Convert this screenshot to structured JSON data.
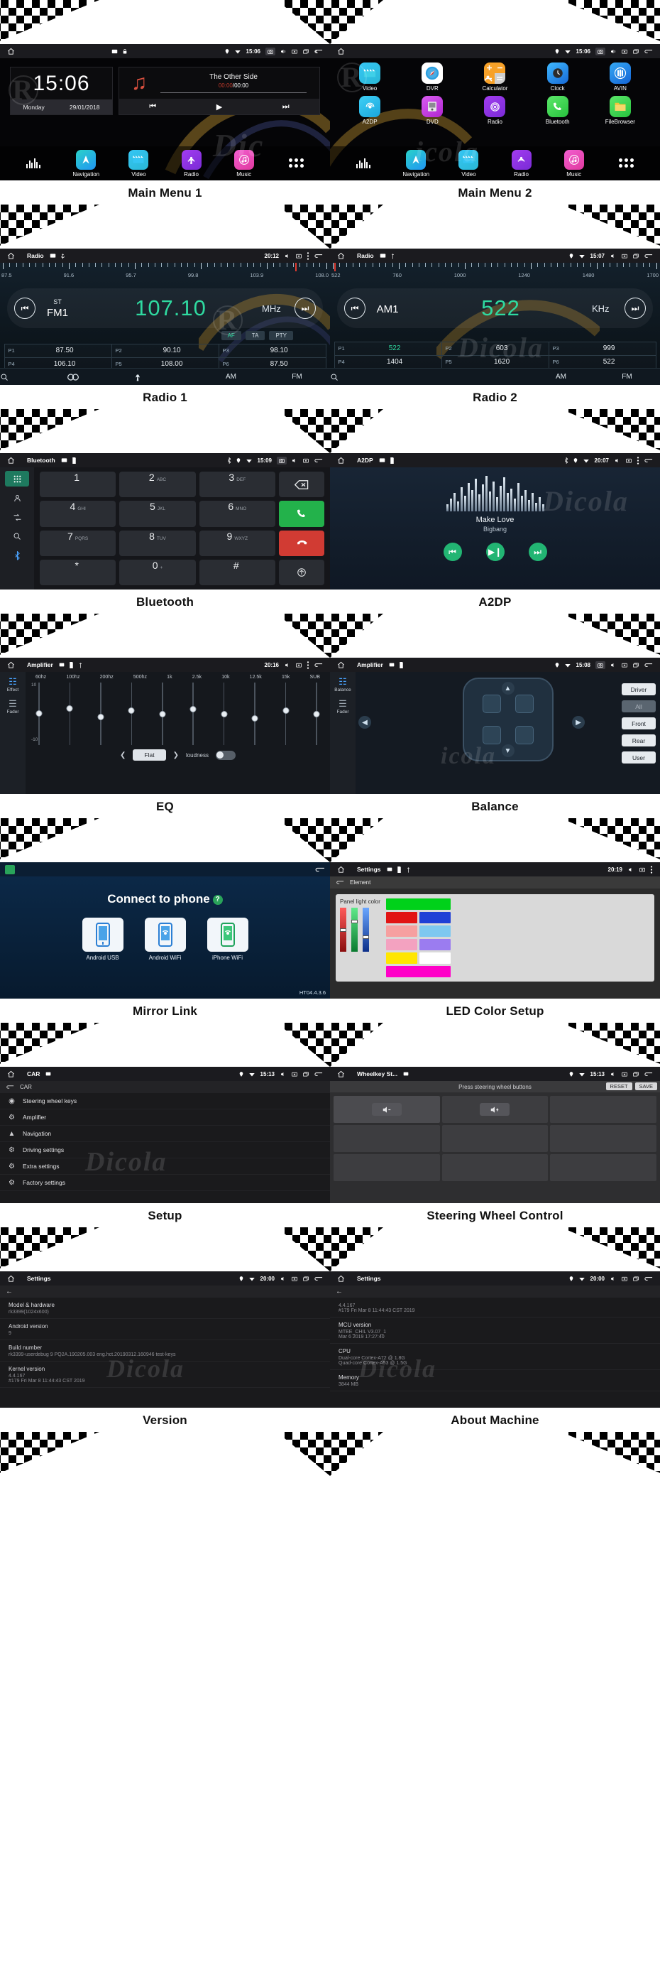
{
  "statusbars": {
    "mm1": {
      "clock": "15:06"
    },
    "mm2": {
      "clock": "15:06"
    },
    "radio1": {
      "title": "Radio",
      "clock": "20:12"
    },
    "radio2": {
      "title": "Radio",
      "clock": "15:07"
    },
    "bt": {
      "title": "Bluetooth",
      "clock": "15:09"
    },
    "a2dp": {
      "title": "A2DP",
      "clock": "20:07"
    },
    "eq": {
      "title": "Amplifier",
      "clock": "20:16"
    },
    "bal": {
      "title": "Amplifier",
      "clock": "15:08"
    },
    "led": {
      "title": "Settings",
      "clock": "20:19"
    },
    "setup": {
      "title": "CAR",
      "clock": "15:13"
    },
    "swc": {
      "title": "Wheelkey St...",
      "clock": "15:13"
    },
    "ver": {
      "title": "Settings",
      "clock": "20:00"
    },
    "about": {
      "title": "Settings",
      "clock": "20:00"
    }
  },
  "captions": {
    "main_menu_1": "Main Menu 1",
    "main_menu_2": "Main Menu 2",
    "radio_1": "Radio 1",
    "radio_2": "Radio 2",
    "bluetooth": "Bluetooth",
    "a2dp": "A2DP",
    "eq": "EQ",
    "balance": "Balance",
    "mirror_link": "Mirror Link",
    "led_color_setup": "LED Color Setup",
    "setup": "Setup",
    "steering_wheel_control": "Steering Wheel Control",
    "version": "Version",
    "about_machine": "About Machine"
  },
  "main_menu_1": {
    "clock_widget": {
      "time": "15:06",
      "day": "Monday",
      "date": "29/01/2018"
    },
    "music_widget": {
      "title": "The Other Side",
      "elapsed": "00:00",
      "total": "00:00",
      "prev": "prev-icon",
      "play": "play-icon",
      "next": "next-icon"
    },
    "dock": [
      {
        "label": "",
        "icon": "equalizer-icon"
      },
      {
        "label": "Navigation",
        "icon": "navigation-icon"
      },
      {
        "label": "Video",
        "icon": "video-icon"
      },
      {
        "label": "Radio",
        "icon": "radio-icon"
      },
      {
        "label": "Music",
        "icon": "music-icon"
      },
      {
        "label": "",
        "icon": "app-drawer-icon"
      }
    ]
  },
  "main_menu_2": {
    "row1": [
      {
        "label": "Video",
        "icon": "video-icon"
      },
      {
        "label": "DVR",
        "icon": "dvr-icon"
      },
      {
        "label": "Calculator",
        "icon": "calculator-icon"
      },
      {
        "label": "Clock",
        "icon": "clock-icon"
      },
      {
        "label": "AVIN",
        "icon": "avin-icon"
      }
    ],
    "row2": [
      {
        "label": "A2DP",
        "icon": "a2dp-icon"
      },
      {
        "label": "DVD",
        "icon": "dvd-icon"
      },
      {
        "label": "Radio",
        "icon": "radio-icon"
      },
      {
        "label": "Bluetooth",
        "icon": "bluetooth-phone-icon"
      },
      {
        "label": "FileBrowser",
        "icon": "filebrowser-icon"
      }
    ],
    "dock": [
      {
        "label": "",
        "icon": "equalizer-icon"
      },
      {
        "label": "Navigation",
        "icon": "navigation-icon"
      },
      {
        "label": "Video",
        "icon": "video-icon"
      },
      {
        "label": "Radio",
        "icon": "radio-icon"
      },
      {
        "label": "Music",
        "icon": "music-icon"
      },
      {
        "label": "",
        "icon": "app-drawer-icon"
      }
    ]
  },
  "radio_1": {
    "scale_labels": [
      "87.5",
      "91.6",
      "95.7",
      "99.8",
      "103.9",
      "108.0"
    ],
    "stereo_label": "ST",
    "band": "FM1",
    "frequency": "107.10",
    "unit": "MHz",
    "rds": [
      "AF",
      "TA",
      "PTY"
    ],
    "presets": [
      {
        "key": "P1",
        "value": "87.50"
      },
      {
        "key": "P2",
        "value": "90.10"
      },
      {
        "key": "P3",
        "value": "98.10"
      },
      {
        "key": "P4",
        "value": "106.10"
      },
      {
        "key": "P5",
        "value": "108.00"
      },
      {
        "key": "P6",
        "value": "87.50"
      }
    ],
    "bottom": [
      "search-icon",
      "stereo-icon",
      "scan-icon",
      "AM",
      "FM"
    ]
  },
  "radio_2": {
    "scale_labels": [
      "522",
      "760",
      "1000",
      "1240",
      "1480",
      "1700"
    ],
    "band": "AM1",
    "frequency": "522",
    "unit": "KHz",
    "presets": [
      {
        "key": "P1",
        "value": "522"
      },
      {
        "key": "P2",
        "value": "603"
      },
      {
        "key": "P3",
        "value": "999"
      },
      {
        "key": "P4",
        "value": "1404"
      },
      {
        "key": "P5",
        "value": "1620"
      },
      {
        "key": "P6",
        "value": "522"
      }
    ],
    "bottom": [
      "search-icon",
      "AM",
      "FM"
    ]
  },
  "bluetooth": {
    "side_icons": [
      "dialpad-icon",
      "contacts-icon",
      "call-log-icon",
      "search-icon",
      "bluetooth-icon"
    ],
    "keys": [
      {
        "num": "1",
        "sub": ""
      },
      {
        "num": "2",
        "sub": "ABC"
      },
      {
        "num": "3",
        "sub": "DEF"
      },
      {
        "num": "4",
        "sub": "GHI"
      },
      {
        "num": "5",
        "sub": "JKL"
      },
      {
        "num": "6",
        "sub": "MNO"
      },
      {
        "num": "7",
        "sub": "PQRS"
      },
      {
        "num": "8",
        "sub": "TUV"
      },
      {
        "num": "9",
        "sub": "WXYZ"
      },
      {
        "num": "*",
        "sub": ""
      },
      {
        "num": "0",
        "sub": "+"
      },
      {
        "num": "#",
        "sub": ""
      }
    ],
    "actions": [
      "backspace-icon",
      "call-icon",
      "hangup-icon",
      "transfer-icon"
    ]
  },
  "a2dp": {
    "title": "Make Love",
    "artist": "Bigbang",
    "controls": [
      "prev-icon",
      "play-icon",
      "next-icon"
    ]
  },
  "eq": {
    "side": [
      {
        "label": "Effect",
        "icon": "effect-icon"
      },
      {
        "label": "Fader",
        "icon": "fader-icon"
      }
    ],
    "bands": [
      "60hz",
      "100hz",
      "200hz",
      "500hz",
      "1k",
      "2.5k",
      "10k",
      "12.5k",
      "15k",
      "SUB"
    ],
    "values": [
      0,
      2,
      -1,
      1,
      0,
      1,
      0,
      -1,
      1,
      0
    ],
    "scale_top": "10",
    "scale_bottom": "-10",
    "preset": "Flat",
    "loudness_label": "loudness",
    "loudness_on": false
  },
  "balance": {
    "side": [
      {
        "label": "Balance",
        "icon": "balance-icon"
      },
      {
        "label": "Fader",
        "icon": "fader-icon"
      }
    ],
    "buttons": [
      {
        "label": "Driver",
        "active": true
      },
      {
        "label": "All",
        "active": false
      },
      {
        "label": "Front",
        "active": true
      },
      {
        "label": "Rear",
        "active": true
      },
      {
        "label": "User",
        "active": true
      }
    ]
  },
  "mirror_link": {
    "heading": "Connect to phone",
    "help_icon": "help-icon",
    "cards": [
      {
        "label": "Android USB",
        "icon": "android-usb-icon"
      },
      {
        "label": "Android WiFi",
        "icon": "android-wifi-icon"
      },
      {
        "label": "iPhone WiFi",
        "icon": "iphone-wifi-icon"
      }
    ],
    "version": "HT04.4.3.6"
  },
  "led_color": {
    "breadcrumb": "Element",
    "panel_label": "Panel light color",
    "channels": [
      {
        "name": "red",
        "color": "#e02020",
        "level": 55
      },
      {
        "name": "green",
        "color": "#22c55e",
        "level": 72
      },
      {
        "name": "blue",
        "color": "#2563eb",
        "level": 40
      }
    ],
    "swatches": [
      "#00d11a",
      "#00e01e",
      "#e11414",
      "#1fc34a",
      "#f6a0a0",
      "#7ec8f0",
      "#f3a2c0",
      "#9b7cf0",
      "#ffe600",
      "#ffffff",
      "#ff00c8"
    ]
  },
  "setup": {
    "breadcrumb": "CAR",
    "items": [
      {
        "label": "Steering wheel keys",
        "icon": "steering-wheel-icon"
      },
      {
        "label": "Amplifier",
        "icon": "amplifier-icon"
      },
      {
        "label": "Navigation",
        "icon": "navigation-icon"
      },
      {
        "label": "Driving settings",
        "icon": "driving-icon"
      },
      {
        "label": "Extra settings",
        "icon": "extra-icon"
      },
      {
        "label": "Factory settings",
        "icon": "factory-icon"
      }
    ]
  },
  "steering": {
    "hint": "Press steering wheel buttons",
    "reset_label": "RESET",
    "save_label": "SAVE",
    "keys": [
      "volume-down-icon",
      "volume-up-icon"
    ]
  },
  "version": {
    "items": [
      {
        "key": "Model & hardware",
        "value": "rk3399(1024x600)"
      },
      {
        "key": "Android version",
        "value": "9"
      },
      {
        "key": "Build number",
        "value": "rk3399-userdebug 9 PQ2A.190205.003 eng.hct.20190312.160946 test-keys"
      },
      {
        "key": "Kernel version",
        "value": "4.4.167\n#179 Fri Mar 8 11:44:43 CST 2019"
      }
    ]
  },
  "about": {
    "items": [
      {
        "key": "",
        "value": "4.4.167\n#179 Fri Mar 8 11:44:43 CST 2019"
      },
      {
        "key": "MCU version",
        "value": "MTEE_CHIL V3.07_1\nMar 6 2019 17:27:40"
      },
      {
        "key": "CPU",
        "value": "Dual-core Cortex-A72 @ 1.8G\nQuad-core Cortex-A53 @ 1.5G"
      },
      {
        "key": "Memory",
        "value": "3844 MB"
      }
    ]
  }
}
